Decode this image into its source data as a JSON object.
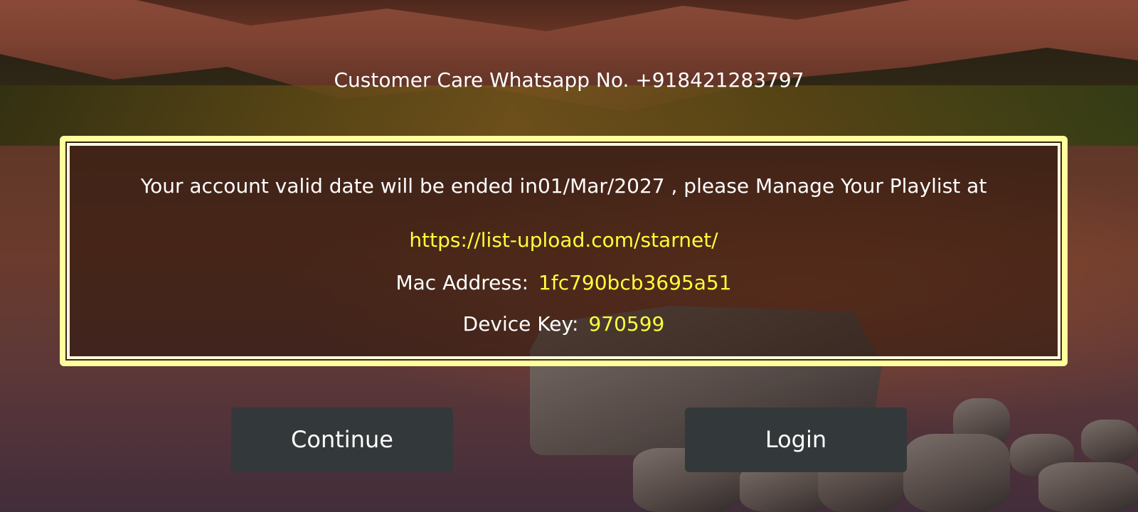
{
  "header": {
    "customer_care": "Customer Care Whatsapp No. +918421283797"
  },
  "info": {
    "message": "Your account valid date will be ended in01/Mar/2027 , please Manage Your Playlist at",
    "url": "https://list-upload.com/starnet/",
    "mac_label": "Mac Address:",
    "mac_value": "1fc790bcb3695a51",
    "device_key_label": "Device Key:",
    "device_key_value": "970599"
  },
  "buttons": {
    "continue_label": "Continue",
    "login_label": "Login"
  },
  "colors": {
    "frame": "#ffff9c",
    "highlight_text": "#ffff3a",
    "button_bg": "#33383a"
  }
}
